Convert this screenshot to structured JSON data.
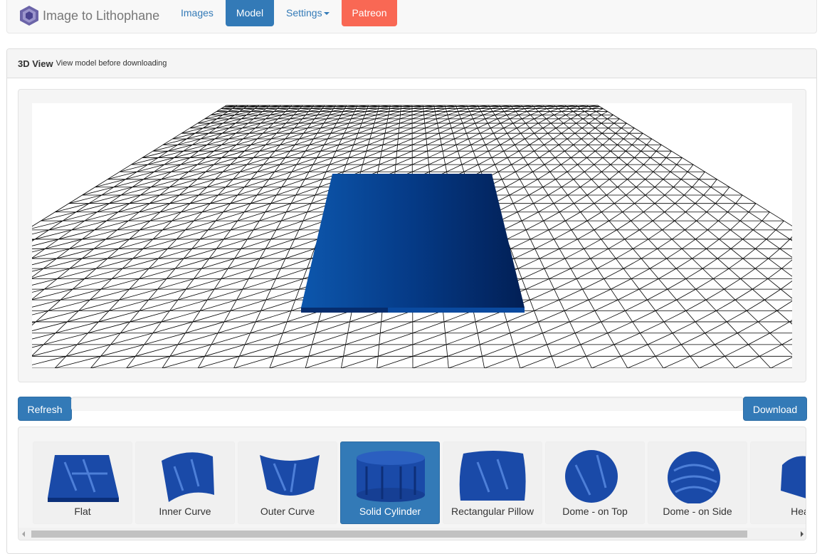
{
  "brand": {
    "title": "Image to Lithophane",
    "logo_icon": "lithophane-logo-icon"
  },
  "nav": {
    "images": "Images",
    "model": "Model",
    "settings": "Settings",
    "patreon": "Patreon"
  },
  "panel": {
    "title": "3D View",
    "subtitle": "View model before downloading"
  },
  "buttons": {
    "refresh": "Refresh",
    "download": "Download"
  },
  "shapes": [
    {
      "label": "Flat",
      "active": false
    },
    {
      "label": "Inner Curve",
      "active": false
    },
    {
      "label": "Outer Curve",
      "active": false
    },
    {
      "label": "Solid Cylinder",
      "active": true
    },
    {
      "label": "Rectangular Pillow",
      "active": false
    },
    {
      "label": "Dome - on Top",
      "active": false
    },
    {
      "label": "Dome - on Side",
      "active": false
    },
    {
      "label": "Hea",
      "active": false
    }
  ],
  "colors": {
    "accent": "#337ab7",
    "patreon": "#f96854",
    "model": "#0a3a8a"
  }
}
